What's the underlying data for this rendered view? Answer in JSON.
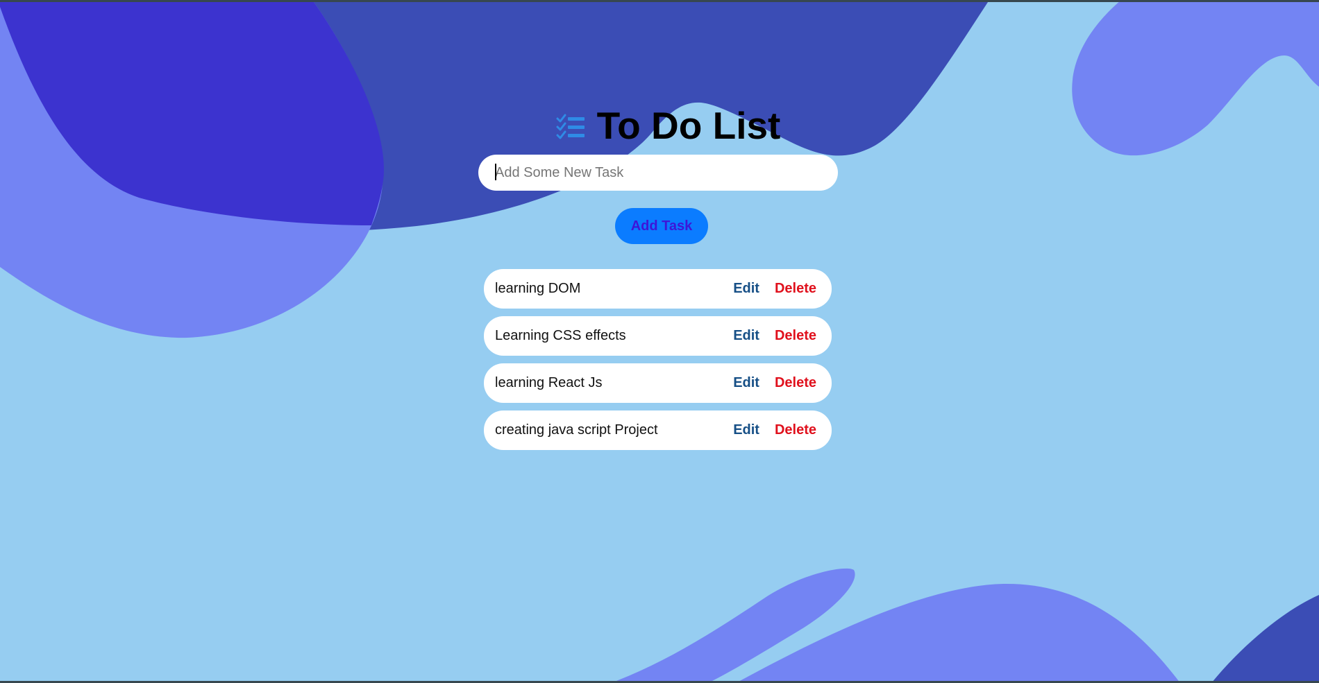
{
  "app": {
    "title": "To Do List",
    "title_icon": "checklist-icon"
  },
  "input": {
    "placeholder": "Add Some New Task",
    "value": ""
  },
  "add_button": {
    "label": "Add Task"
  },
  "tasks": [
    {
      "text": "learning DOM",
      "edit_label": "Edit",
      "delete_label": "Delete"
    },
    {
      "text": "Learning CSS effects",
      "edit_label": "Edit",
      "delete_label": "Delete"
    },
    {
      "text": "learning React Js",
      "edit_label": "Edit",
      "delete_label": "Delete"
    },
    {
      "text": "creating java script Project",
      "edit_label": "Edit",
      "delete_label": "Delete"
    }
  ],
  "colors": {
    "background": "#96cdf1",
    "blob_dark": "#3b4db5",
    "blob_deep": "#3c33cf",
    "blob_light": "#7384f3",
    "add_button_bg": "#0b7cff",
    "add_button_text": "#3d16d8",
    "edit_text": "#164f86",
    "delete_text": "#e0101c"
  }
}
